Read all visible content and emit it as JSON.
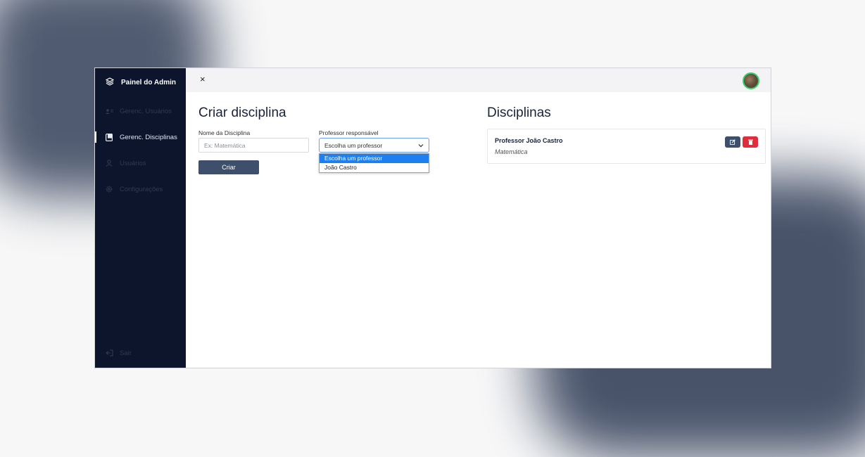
{
  "sidebar": {
    "brand": "Painel do Admin",
    "items": [
      {
        "label": "Gerenc. Usuários",
        "icon": "users-list-icon"
      },
      {
        "label": "Gerenc. Disciplinas",
        "icon": "book-icon",
        "active": true
      },
      {
        "label": "Usuários",
        "icon": "user-icon"
      },
      {
        "label": "Configurações",
        "icon": "gear-icon"
      }
    ],
    "logout": "Sair"
  },
  "topbar": {
    "close": "×"
  },
  "form": {
    "title": "Criar disciplina",
    "name_label": "Nome da Disciplina",
    "name_placeholder": "Ex: Matemática",
    "teacher_label": "Professor responsável",
    "teacher_selected": "Escolha um professor",
    "teacher_options": [
      "Escolha um professor",
      "João Castro"
    ],
    "submit": "Criar"
  },
  "disciplines": {
    "title": "Disciplinas",
    "items": [
      {
        "teacher": "Professor João Castro",
        "subject": "Matemática"
      }
    ]
  },
  "colors": {
    "sidebar": "#0c152b",
    "primary_button": "#3e4f6b",
    "danger_button": "#e02d3c",
    "dropdown_highlight": "#1e80ef",
    "avatar_ring": "#3ad06a"
  }
}
